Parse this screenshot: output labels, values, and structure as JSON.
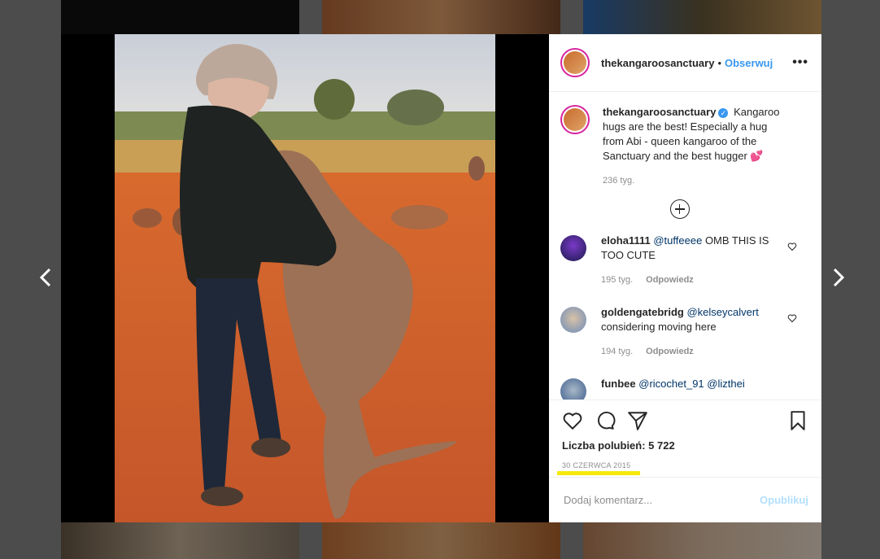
{
  "post": {
    "username": "thekangaroosanctuary",
    "follow_label": "Obserwuj",
    "dot": "•",
    "more_label": "•••",
    "caption": "Kangaroo hugs are the best! Especially a hug from Abi - queen kangaroo of the Sanctuary and the best hugger 💕",
    "caption_age": "236 tyg.",
    "likes_label": "Liczba polubień: 5 722",
    "date": "30 CZERWCA 2015",
    "comment_placeholder": "Dodaj komentarz...",
    "publish_label": "Opublikuj"
  },
  "comments": [
    {
      "user": "eloha1111",
      "mention": "@tuffeeee",
      "text": "OMB THIS IS TOO CUTE",
      "age": "195 tyg.",
      "reply": "Odpowiedz"
    },
    {
      "user": "goldengatebridg",
      "mention": "@kelseycalvert",
      "text": "considering moving here",
      "age": "194 tyg.",
      "reply": "Odpowiedz"
    },
    {
      "user": "funbee",
      "mention": "@ricochet_91 @lizthei",
      "text": "",
      "age": "",
      "reply": ""
    }
  ],
  "colors": {
    "accent": "#3897f0",
    "highlight": "#f5e90a"
  },
  "icons": [
    "heart-icon",
    "comment-icon",
    "share-icon",
    "bookmark-icon",
    "plus-circle-icon",
    "chevron-left-icon",
    "chevron-right-icon",
    "verified-icon"
  ]
}
